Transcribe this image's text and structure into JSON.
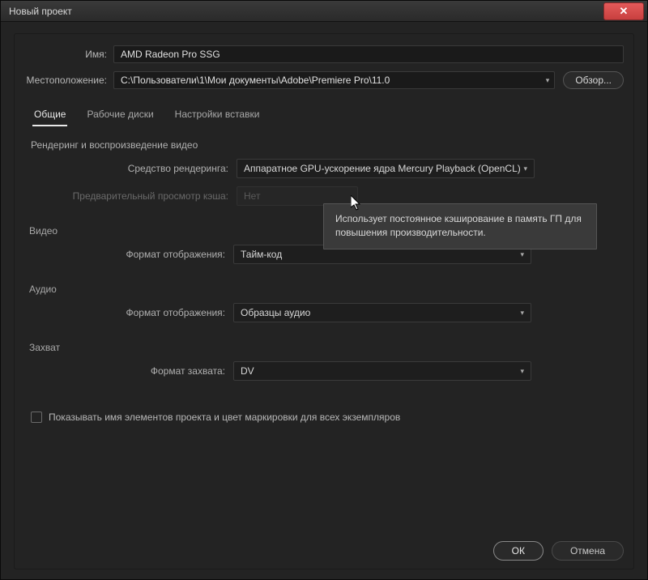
{
  "window": {
    "title": "Новый проект"
  },
  "name_field": {
    "label": "Имя:",
    "value": "AMD Radeon Pro SSG"
  },
  "location_field": {
    "label": "Местоположение:",
    "value": "C:\\Пользователи\\1\\Мои документы\\Adobe\\Premiere Pro\\11.0",
    "browse": "Обзор..."
  },
  "tabs": {
    "general": "Общие",
    "scratch": "Рабочие диски",
    "ingest": "Настройки вставки"
  },
  "rendering_section": {
    "title": "Рендеринг и воспроизведение видео",
    "renderer_label": "Средство рендеринга:",
    "renderer_value": "Аппаратное GPU-ускорение ядра Mercury Playback (OpenCL)",
    "cache_label": "Предварительный просмотр кэша:",
    "cache_value": "Нет"
  },
  "video_section": {
    "title": "Видео",
    "display_label": "Формат отображения:",
    "display_value": "Тайм-код"
  },
  "audio_section": {
    "title": "Аудио",
    "display_label": "Формат отображения:",
    "display_value": "Образцы аудио"
  },
  "capture_section": {
    "title": "Захват",
    "format_label": "Формат захвата:",
    "format_value": "DV"
  },
  "checkbox": {
    "label": "Показывать имя элементов проекта и цвет маркировки для всех экземпляров"
  },
  "tooltip": {
    "text": "Использует постоянное кэширование в память ГП для повышения производительности."
  },
  "footer": {
    "ok": "ОК",
    "cancel": "Отмена"
  }
}
